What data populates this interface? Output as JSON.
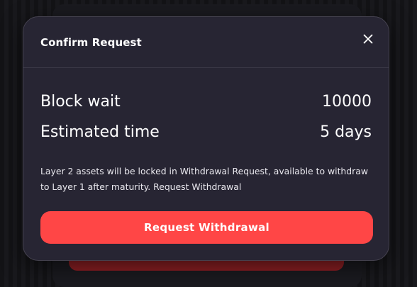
{
  "modal": {
    "title": "Confirm Request",
    "close_icon": "close-icon",
    "rows": [
      {
        "label": "Block wait",
        "value": "10000"
      },
      {
        "label": "Estimated time",
        "value": "5 days"
      }
    ],
    "note": "Layer 2 assets will be locked in Withdrawal Request, available to withdraw to Layer 1 after maturity. Request Withdrawal",
    "primary_button_label": "Request Withdrawal"
  },
  "colors": {
    "accent": "#ff4646",
    "modal_background": "#272533",
    "page_background": "#151518"
  }
}
